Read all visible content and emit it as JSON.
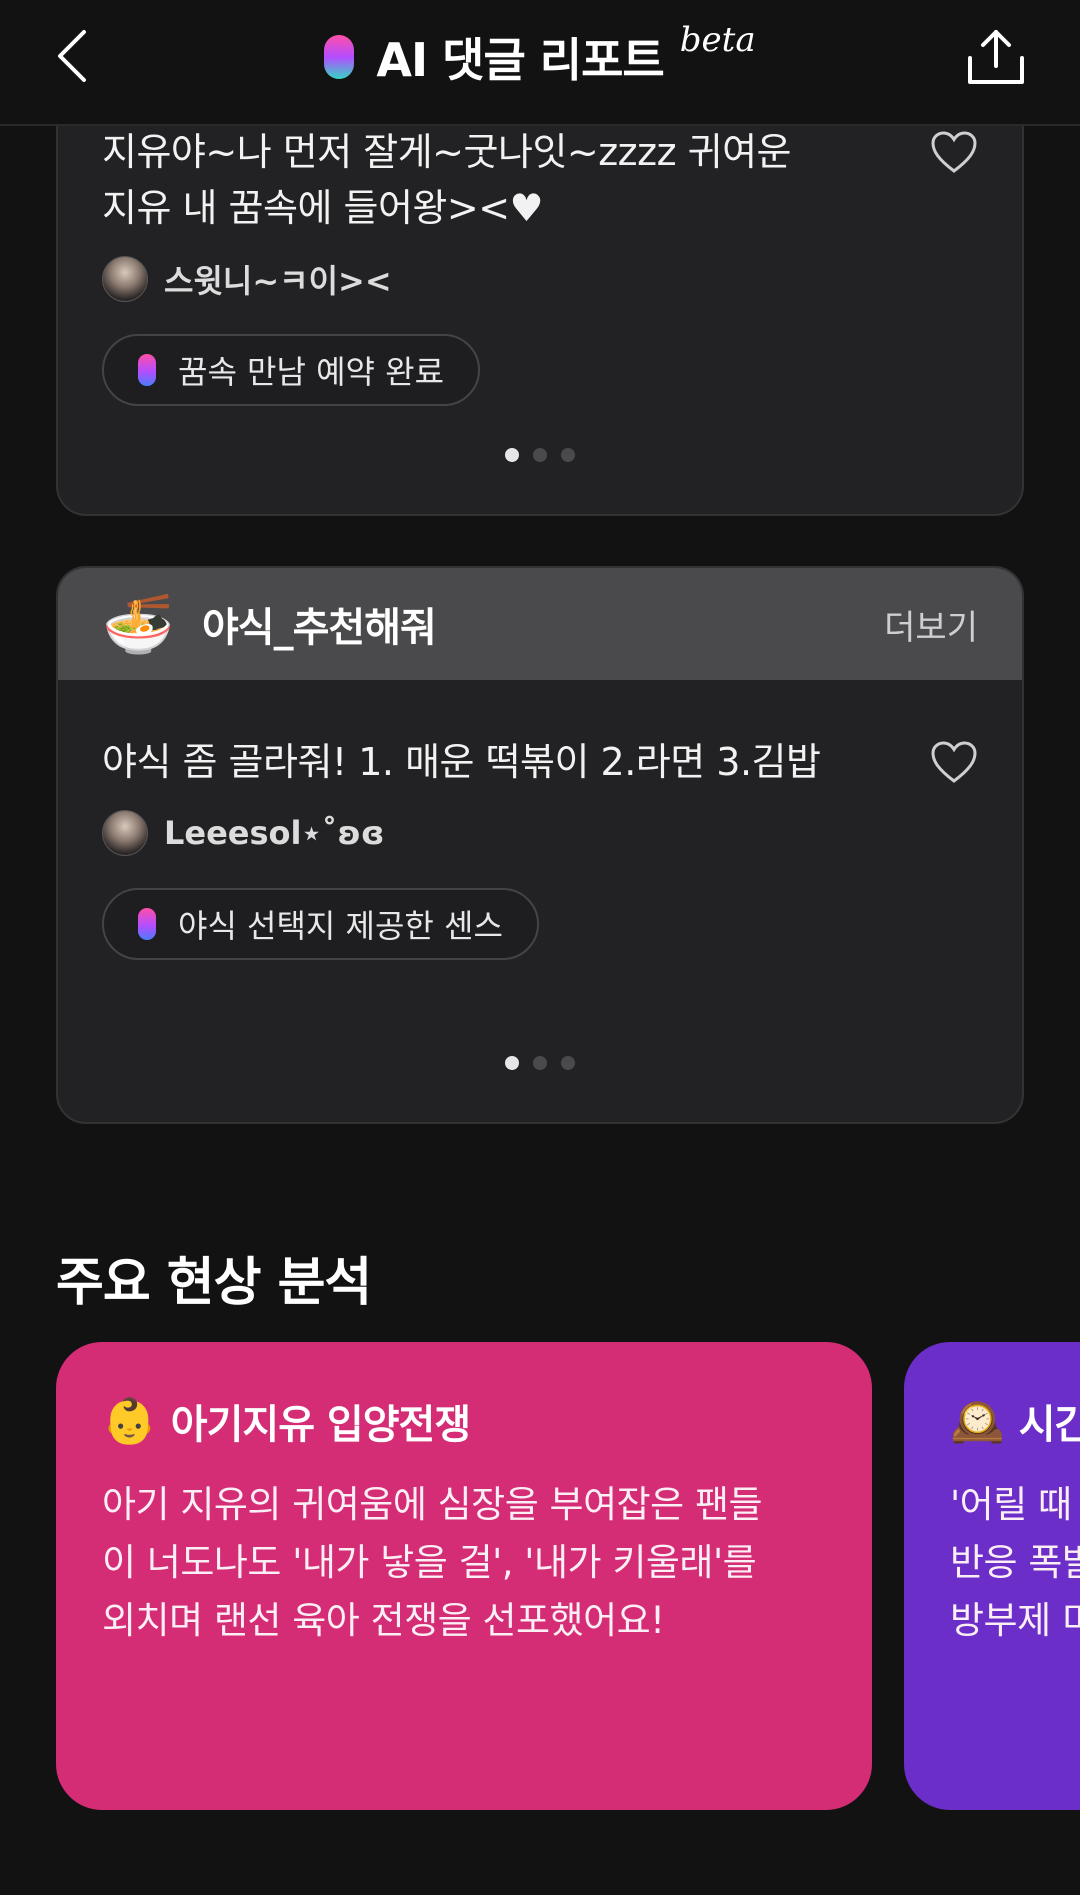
{
  "header": {
    "title": "AI 댓글 리포트",
    "beta_label": "beta"
  },
  "top_card": {
    "comment_lines": [
      "지유야~나 먼저 잘게~굿나잇~zzzz 귀여운",
      "지유 내 꿈속에 들어왕><♥"
    ],
    "author": "스윗니~ㅋ이><",
    "tag": "꿈속 만남 예약 완료",
    "pager": {
      "total": 3,
      "active_index": 0
    }
  },
  "topic_card": {
    "emoji": "🍜",
    "title": "야식_추천해줘",
    "more_label": "더보기",
    "comment": "야식 좀 골라줘! 1. 매운 떡볶이 2.라면 3.김밥",
    "author": "Leeesol⋆˚ʚɞ",
    "tag": "야식 선택지 제공한 센스",
    "pager": {
      "total": 3,
      "active_index": 0
    }
  },
  "analysis": {
    "section_title": "주요 현상 분석",
    "cards": [
      {
        "emoji": "👶",
        "title": "아기지유 입양전쟁",
        "body_lines": [
          "아기 지유의 귀여움에 심장을 부여잡은 팬들",
          "이 너도나도 '내가 낳을 걸', '내가 키울래'를",
          "외치며 랜선 육아 전쟁을 선포했어요!"
        ],
        "color": "#d42d75"
      },
      {
        "emoji": "🕰️",
        "title": "시간",
        "body_lines": [
          "'어릴 때",
          "반응 폭발",
          "방부제 미"
        ],
        "color": "#6c2ec8"
      }
    ]
  },
  "icons": {
    "back": "chevron-left-icon",
    "share": "share-upload-icon",
    "like": "heart-outline-icon"
  },
  "colors": {
    "background": "#121212",
    "card": "#222224",
    "card_header": "#4a4a4c",
    "accent_pink": "#d42d75",
    "accent_purple": "#6c2ec8"
  }
}
